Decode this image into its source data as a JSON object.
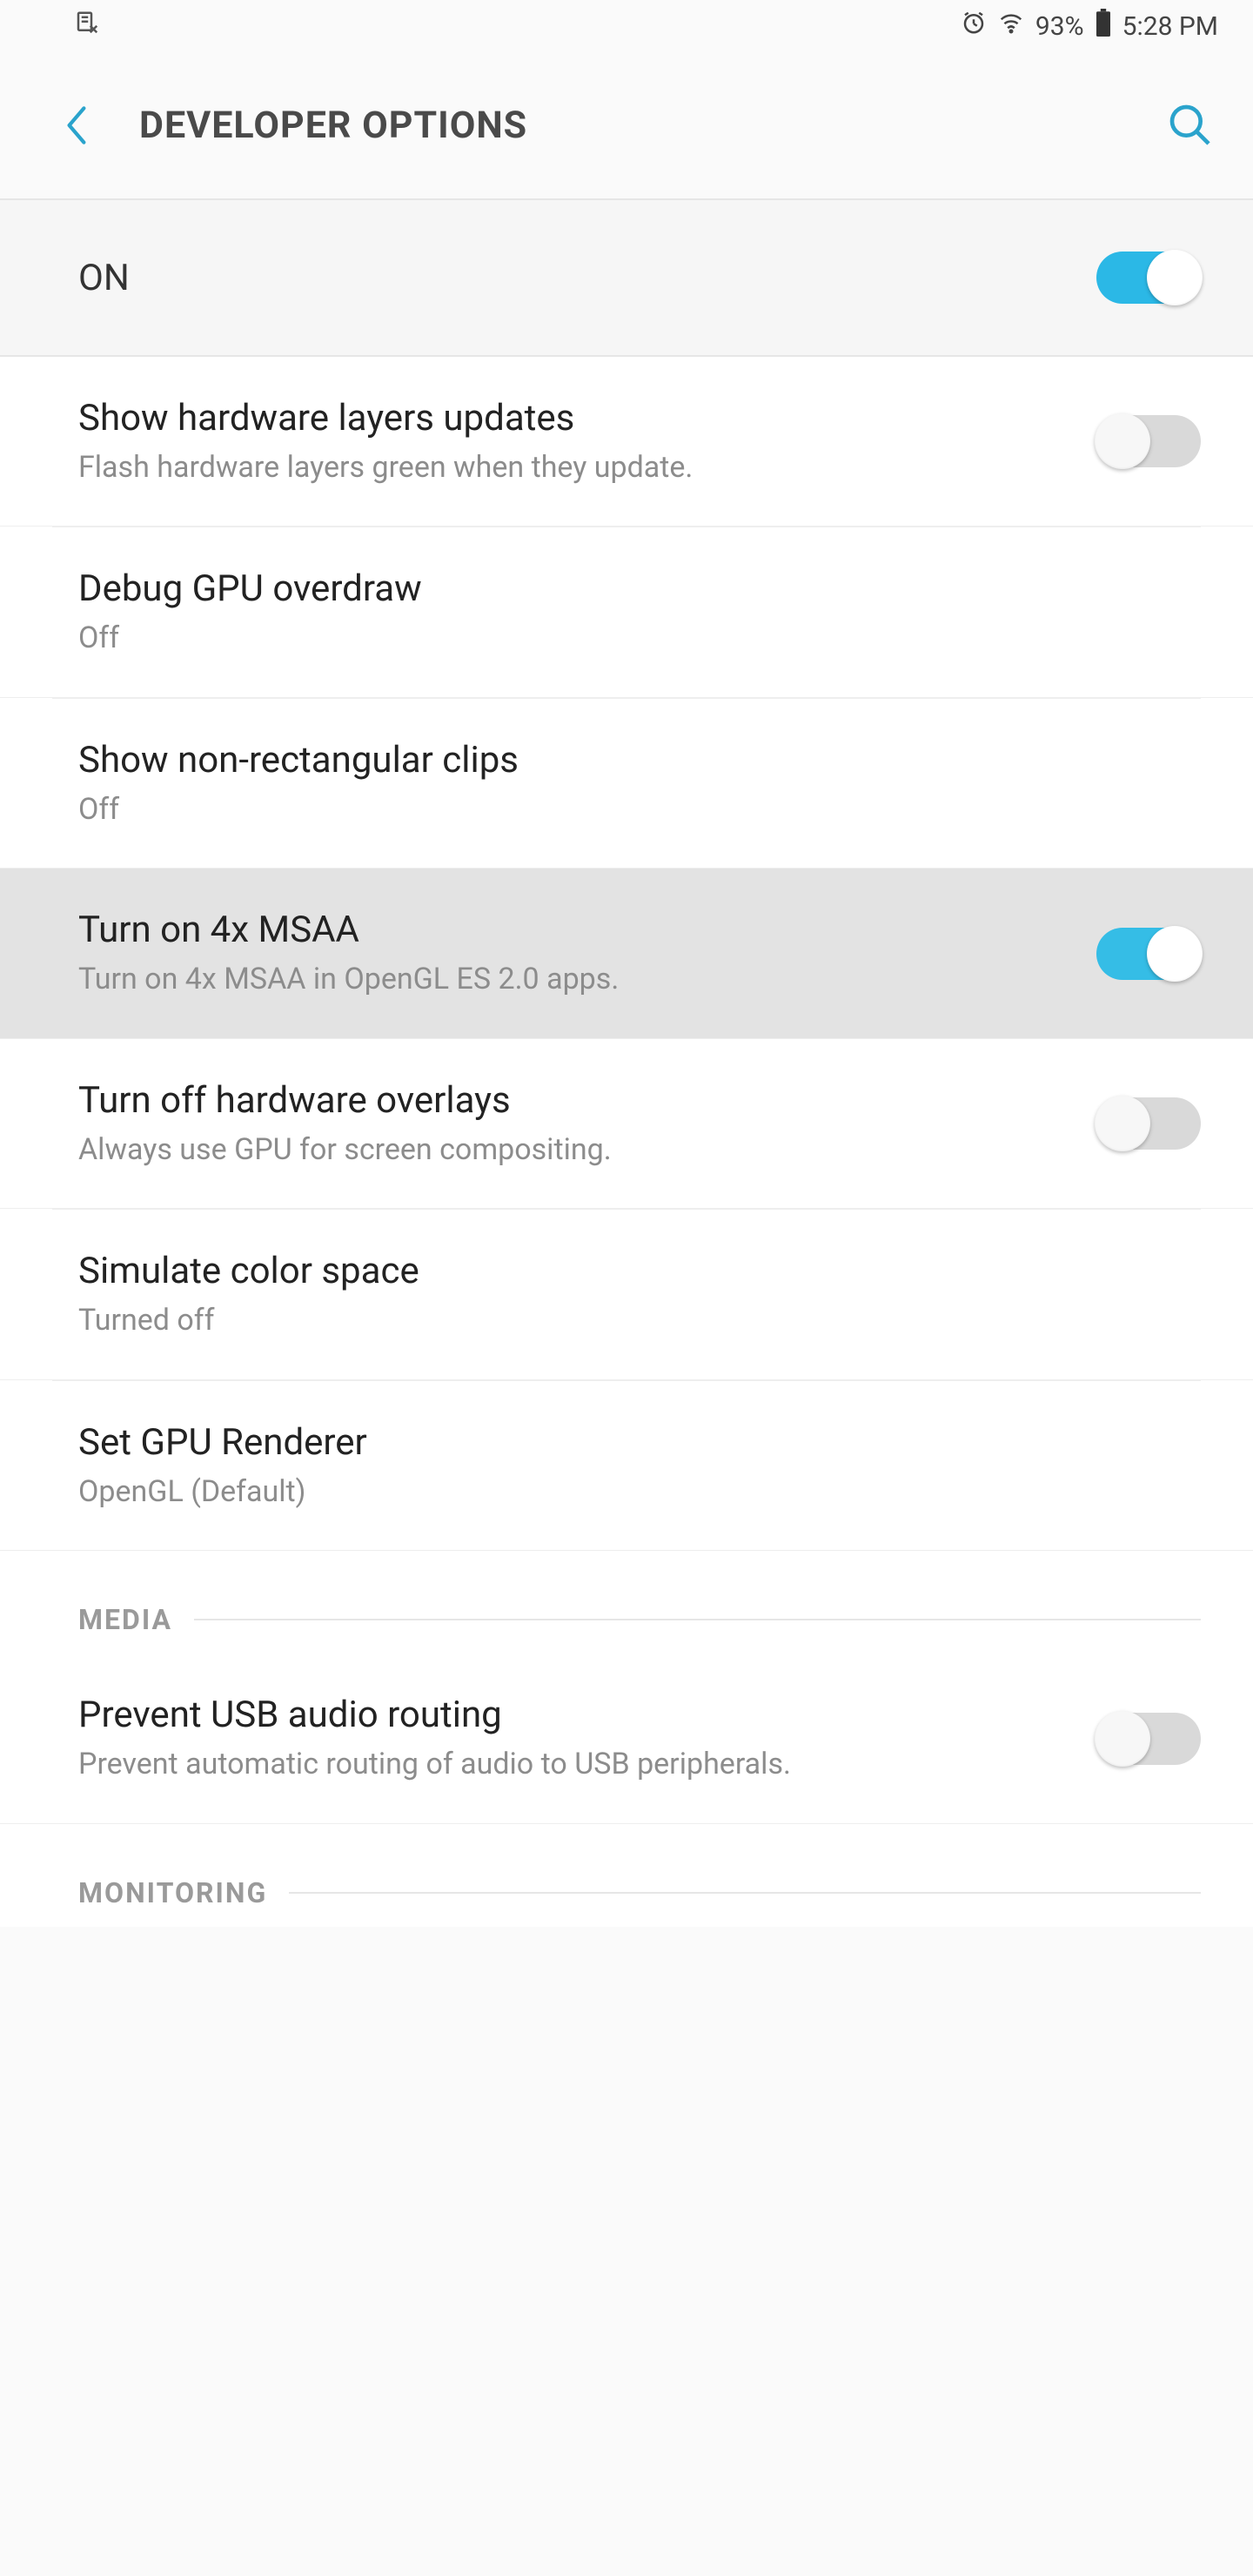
{
  "status": {
    "battery_pct": "93%",
    "time": "5:28 PM"
  },
  "header": {
    "title": "DEVELOPER OPTIONS"
  },
  "master": {
    "label": "ON",
    "on": true
  },
  "items": [
    {
      "title": "Show hardware layers updates",
      "sub": "Flash hardware layers green when they update.",
      "toggle": false
    },
    {
      "title": "Debug GPU overdraw",
      "sub": "Off"
    },
    {
      "title": "Show non-rectangular clips",
      "sub": "Off"
    },
    {
      "title": "Turn on 4x MSAA",
      "sub": "Turn on 4x MSAA in OpenGL ES 2.0 apps.",
      "toggle": true,
      "highlight": true
    },
    {
      "title": "Turn off hardware overlays",
      "sub": "Always use GPU for screen compositing.",
      "toggle": false
    },
    {
      "title": "Simulate color space",
      "sub": "Turned off"
    },
    {
      "title": "Set GPU Renderer",
      "sub": "OpenGL (Default)"
    }
  ],
  "sections": {
    "media": "MEDIA",
    "monitoring": "MONITORING"
  },
  "media_items": [
    {
      "title": "Prevent USB audio routing",
      "sub": "Prevent automatic routing of audio to USB peripherals.",
      "toggle": false
    }
  ]
}
